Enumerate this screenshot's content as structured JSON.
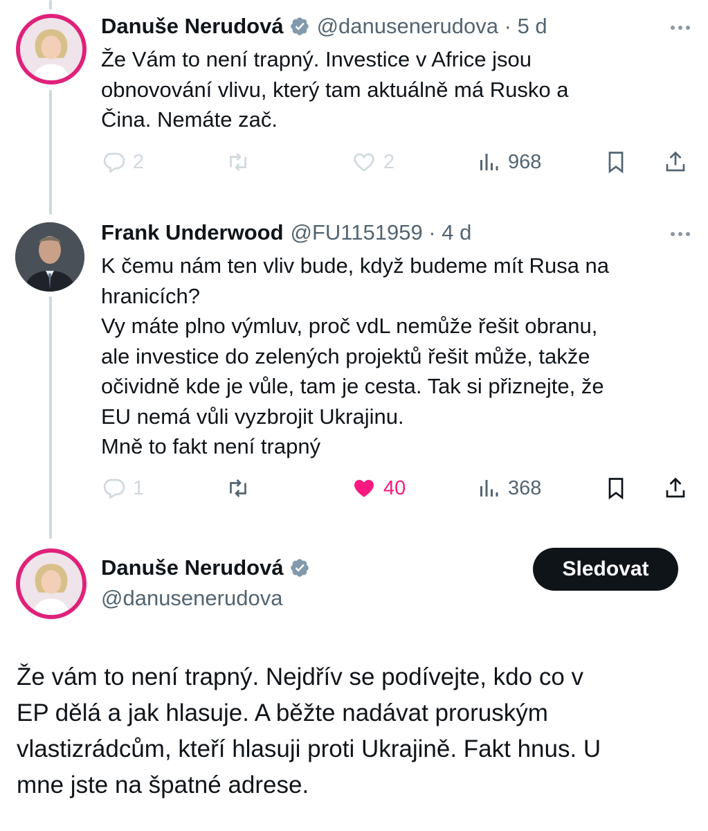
{
  "tweet1": {
    "name": "Danuše Nerudová",
    "handle": "@danusenerudova · 5 d",
    "lines": [
      "Že Vám to není trapný. Investice v Africe jsou",
      "obnovování vlivu, který tam aktuálně má Rusko a",
      "Čina. Nemáte zač."
    ],
    "replies": "2",
    "likes": "2",
    "views": "968"
  },
  "tweet2": {
    "name": "Frank Underwood",
    "handle": "@FU1151959 · 4 d",
    "lines": [
      "K čemu nám ten vliv bude, když budeme mít Rusa na",
      "hranicích?",
      "Vy máte plno výmluv, proč vdL nemůže řešit obranu,",
      "ale investice do zelených projektů řešit může, takže",
      "očividně kde je vůle, tam je cesta. Tak si přiznejte, že",
      "EU nemá vůli vyzbrojit Ukrajinu.",
      "Mně to fakt není trapný"
    ],
    "replies": "1",
    "likes": "40",
    "views": "368"
  },
  "main": {
    "name": "Danuše Nerudová",
    "handle": "@danusenerudova",
    "follow_label": "Sledovat",
    "lines": [
      "Že vám to není trapný. Nejdřív se podívejte, kdo co v",
      "EP dělá a jak hlasuje. A běžte nadávat proruským",
      "vlastizrádcům, kteří hlasuji proti Ukrajině. Fakt hnus. U",
      "mne jste na špatné adrese."
    ]
  },
  "icons": {
    "reply": "reply-icon",
    "retweet": "retweet-icon",
    "like": "heart-icon",
    "views": "views-icon",
    "bookmark": "bookmark-icon",
    "share": "share-icon",
    "verified": "verified-badge-icon",
    "more": "more-icon"
  },
  "colors": {
    "accent_like": "#f91880",
    "verified_gray": "#829aab",
    "avatar_ring": "#e0217a",
    "follow_button": "#0f1419"
  }
}
